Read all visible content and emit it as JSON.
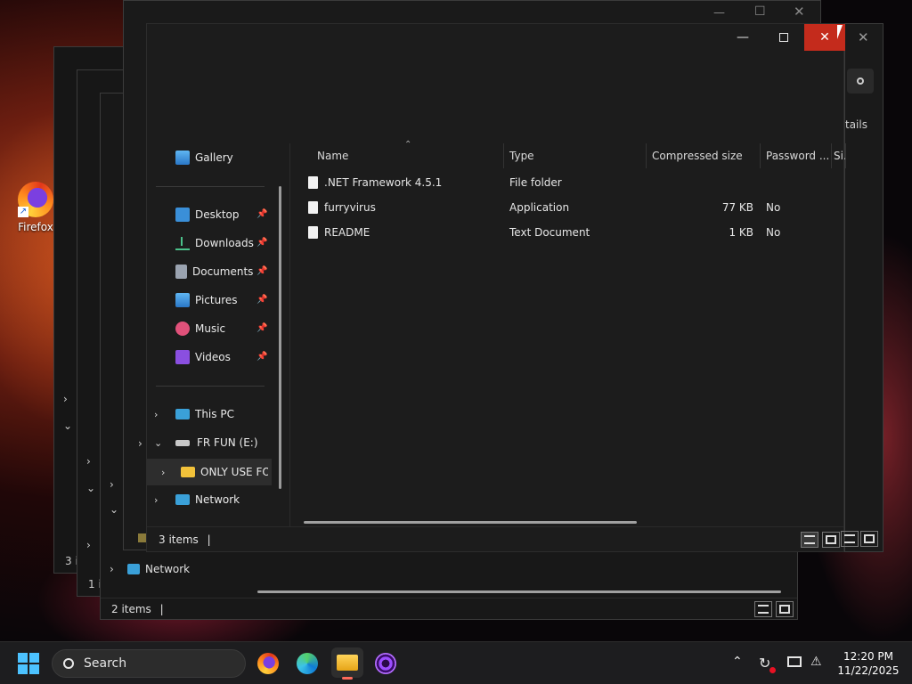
{
  "desktop": {
    "icon_label": "Firefox"
  },
  "explorer": {
    "sidebar": {
      "gallery": "Gallery",
      "quick": [
        {
          "label": "Desktop"
        },
        {
          "label": "Downloads"
        },
        {
          "label": "Documents"
        },
        {
          "label": "Pictures"
        },
        {
          "label": "Music"
        },
        {
          "label": "Videos"
        }
      ],
      "this_pc": "This PC",
      "drive": "FR FUN (E:)",
      "folder": "ONLY USE FOR",
      "network": "Network"
    },
    "columns": [
      "Name",
      "Type",
      "Compressed size",
      "Password ...",
      "Si...",
      "Si"
    ],
    "rows": [
      {
        "name": ".NET Framework 4.5.1",
        "type": "File folder",
        "size": "",
        "password": ""
      },
      {
        "name": "furryvirus",
        "type": "Application",
        "size": "77 KB",
        "password": "No"
      },
      {
        "name": "README",
        "type": "Text Document",
        "size": "1 KB",
        "password": "No"
      }
    ],
    "status": "3 items",
    "details_label": "tails"
  },
  "background_windows": {
    "network": "Network",
    "status_2": "2 items",
    "partial_3": "3 i",
    "partial_1": "1 i",
    "partial_3b": "3 i"
  },
  "taskbar": {
    "search_placeholder": "Search",
    "time": "12:20 PM",
    "date": "11/22/2025"
  }
}
